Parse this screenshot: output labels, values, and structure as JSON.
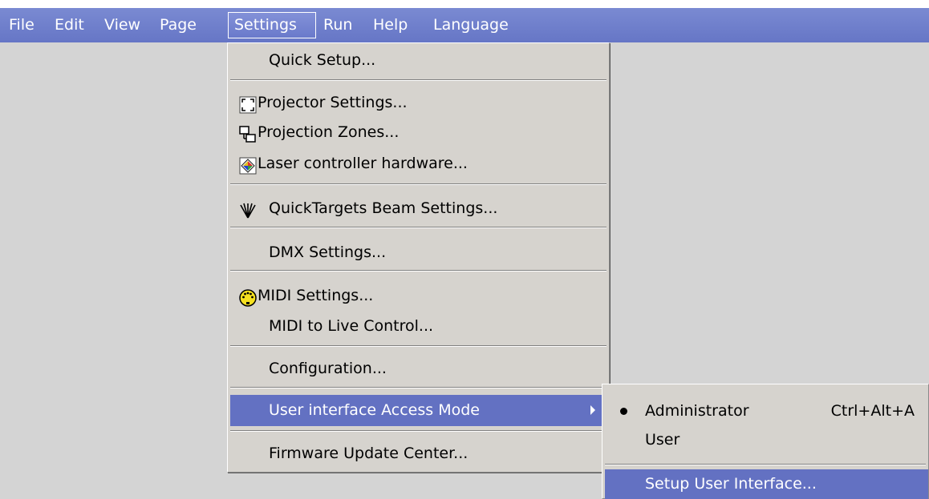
{
  "menubar": {
    "items": [
      {
        "label": "File"
      },
      {
        "label": "Edit"
      },
      {
        "label": "View"
      },
      {
        "label": "Page"
      },
      {
        "label": "Settings"
      },
      {
        "label": "Run"
      },
      {
        "label": "Help"
      },
      {
        "label": "Language"
      }
    ]
  },
  "settings_menu": {
    "quick_setup": "Quick Setup...",
    "projector_settings": "Projector Settings...",
    "projection_zones": "Projection Zones...",
    "laser_controller": "Laser controller hardware...",
    "quicktargets": "QuickTargets Beam Settings...",
    "dmx_settings": "DMX Settings...",
    "midi_settings": "MIDI Settings...",
    "midi_live_control": "MIDI to Live Control...",
    "configuration": "Configuration...",
    "access_mode": "User interface Access Mode",
    "firmware_update": "Firmware Update Center..."
  },
  "access_submenu": {
    "administrator": "Administrator",
    "administrator_shortcut": "Ctrl+Alt+A",
    "user": "User",
    "setup_ui": "Setup User Interface..."
  },
  "colors": {
    "menubar": "#6676c6",
    "highlight": "#6371c2",
    "menu_bg": "#d6d3ce"
  }
}
